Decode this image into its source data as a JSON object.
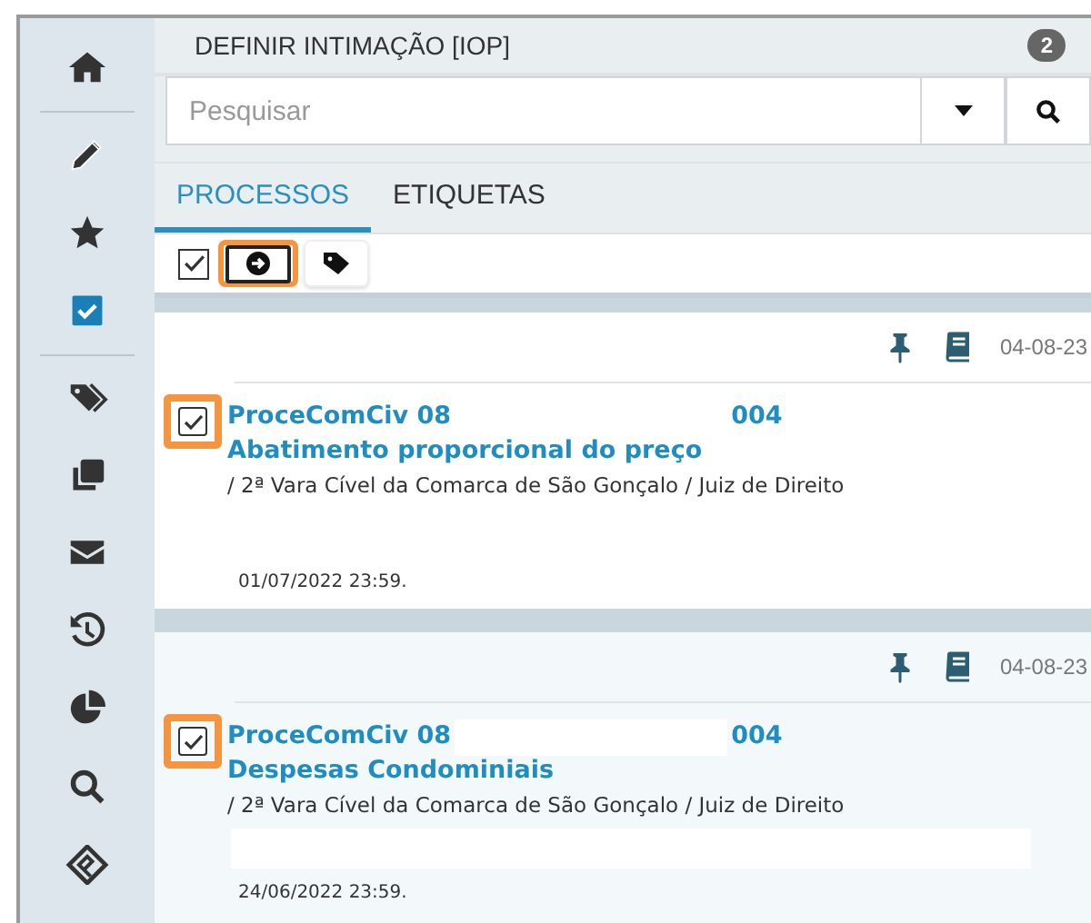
{
  "window": {
    "title": "DEFINIR INTIMAÇÃO [IOP]",
    "badge": "2"
  },
  "sidebar": {
    "items": [
      {
        "kind": "home"
      },
      {
        "kind": "pencil"
      },
      {
        "kind": "star"
      },
      {
        "kind": "checkbox"
      },
      {
        "kind": "tags"
      },
      {
        "kind": "copy"
      },
      {
        "kind": "mail"
      },
      {
        "kind": "history"
      },
      {
        "kind": "chart"
      },
      {
        "kind": "search"
      },
      {
        "kind": "logo"
      }
    ]
  },
  "search": {
    "placeholder": "Pesquisar"
  },
  "tabs": [
    {
      "label": "PROCESSOS",
      "selected": true
    },
    {
      "label": "ETIQUETAS",
      "selected": false
    }
  ],
  "toolbar": {
    "select_all": {
      "checked": true
    },
    "buttons": [
      {
        "kind": "arrow",
        "annotated": true
      },
      {
        "kind": "tag",
        "annotated": false
      }
    ]
  },
  "cards": [
    {
      "highlighted": false,
      "date": "04-08-23",
      "checked": true,
      "annotated": true,
      "number_start": "ProceComCiv 08",
      "number_end": "004",
      "redacted": false,
      "subject": "Abatimento proporcional do preço",
      "court": "/ 2ª Vara Cível da Comarca de São Gonçalo / Juiz de Direito",
      "deadline": "01/07/2022 23:59."
    },
    {
      "highlighted": true,
      "date": "04-08-23",
      "checked": true,
      "annotated": true,
      "number_start": "ProceComCiv 08",
      "number_end": "004",
      "redacted": true,
      "subject": "Despesas Condominiais",
      "court": "/ 2ª Vara Cível da Comarca de São Gonçalo / Juiz de Direito",
      "deadline": "24/06/2022 23:59."
    }
  ]
}
